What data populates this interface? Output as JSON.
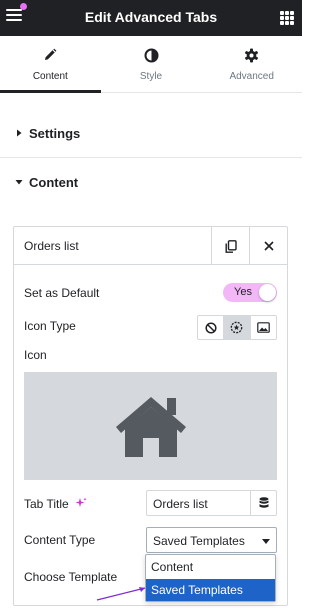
{
  "header": {
    "title": "Edit Advanced Tabs",
    "notification_color": "#e572f0"
  },
  "tabs": [
    {
      "label": "Content",
      "icon": "pencil-icon",
      "active": true
    },
    {
      "label": "Style",
      "icon": "half-circle-icon",
      "active": false
    },
    {
      "label": "Advanced",
      "icon": "gear-icon",
      "active": false
    }
  ],
  "sections": {
    "settings": "Settings",
    "content": "Content"
  },
  "repeater_item": {
    "title": "Orders list",
    "set_default_label": "Set as Default",
    "toggle_text": "Yes",
    "icon_type_label": "Icon Type",
    "icon_label": "Icon",
    "icon_selected": "home-icon",
    "tab_title_label": "Tab Title",
    "tab_title_value": "Orders list",
    "content_type_label": "Content Type",
    "content_type_value": "Saved Templates",
    "choose_template_label": "Choose Template"
  },
  "dropdown": {
    "options": [
      "Content",
      "Saved Templates"
    ],
    "selected": "Saved Templates"
  },
  "colors": {
    "header_bg": "#1f2124",
    "toggle_bg": "#f3b6f7",
    "ai_icon": "#c936d4",
    "selection": "#1e63c7",
    "pointer": "#7b2ad4"
  }
}
